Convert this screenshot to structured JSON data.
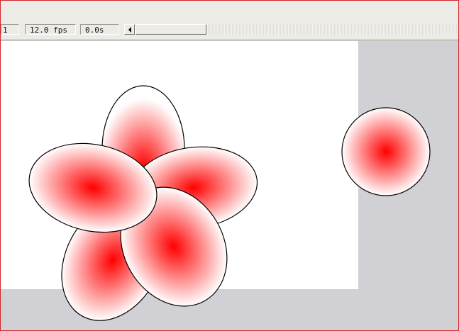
{
  "timeline_status": {
    "current_frame": "1",
    "frame_rate": "12.0 fps",
    "elapsed_time": "0.0s"
  },
  "stage": {
    "background_color": "#ffffff",
    "pasteboard_color": "#d1d0d4"
  },
  "artwork": {
    "gradient_center_color": "#ff0000",
    "gradient_edge_color": "#ffffff",
    "outline_color": "#000000",
    "flower_petal_count": 5,
    "circle_count": 1
  }
}
